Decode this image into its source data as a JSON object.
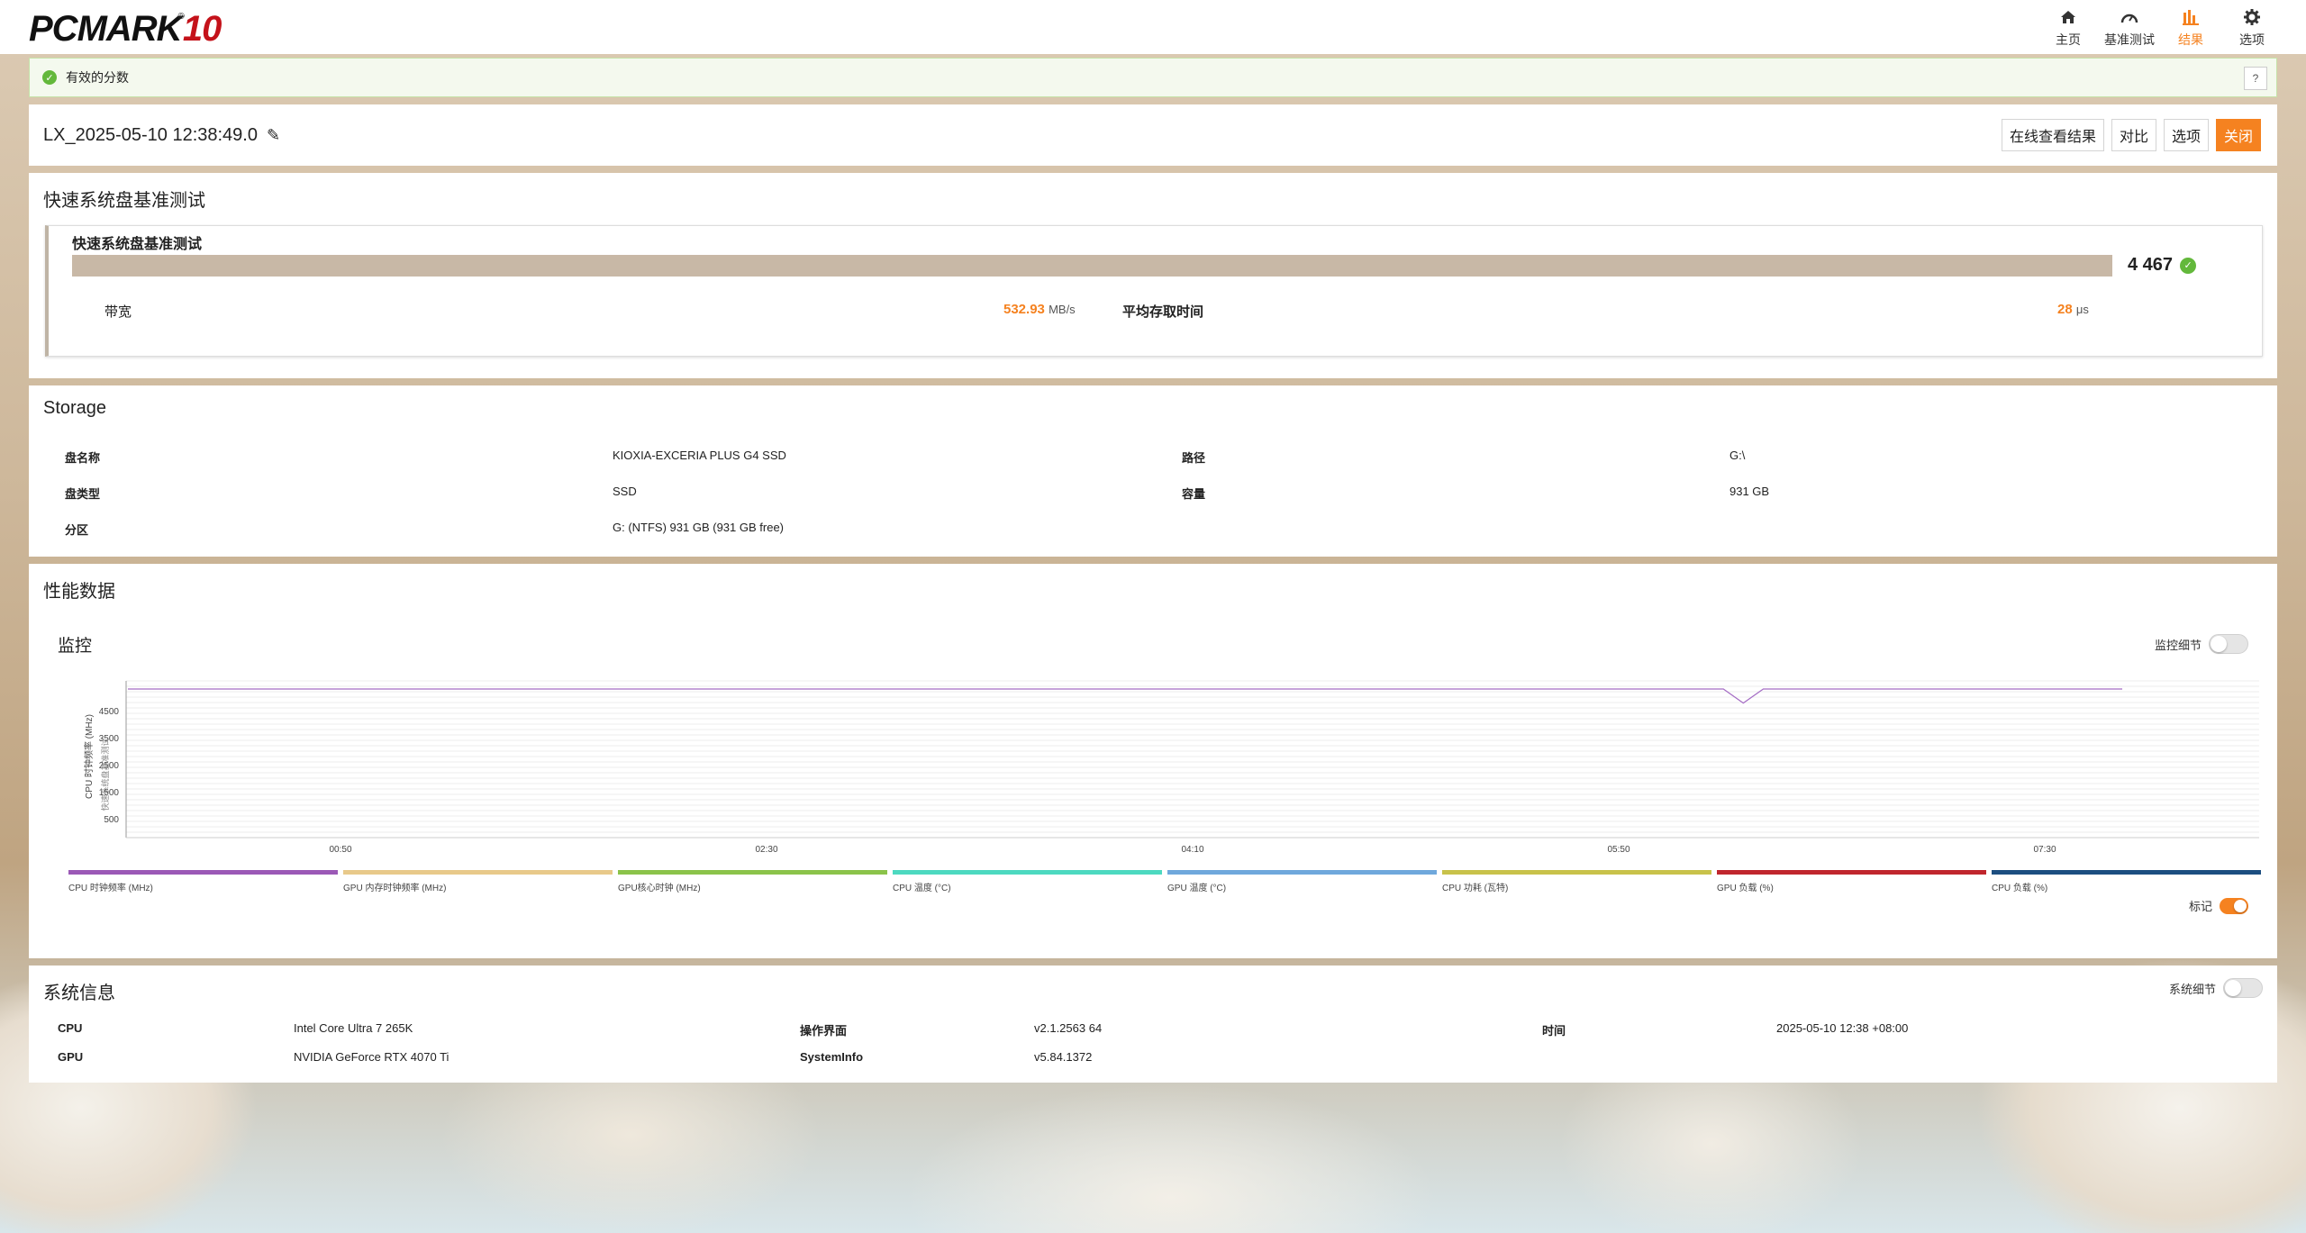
{
  "app": {
    "logo_text": "PCMARK",
    "logo_number": "10",
    "logo_reg": "®"
  },
  "nav": [
    {
      "label": "主页",
      "icon": "home-icon"
    },
    {
      "label": "基准测试",
      "icon": "gauge-icon"
    },
    {
      "label": "结果",
      "icon": "bar-chart-icon",
      "active": true
    },
    {
      "label": "选项",
      "icon": "gear-icon"
    }
  ],
  "status": {
    "text": "有效的分数",
    "help": "?"
  },
  "result": {
    "title": "LX_2025-05-10 12:38:49.0",
    "buttons": {
      "online": "在线查看结果",
      "compare": "对比",
      "options": "选项",
      "close": "关闭"
    }
  },
  "benchmark": {
    "section": "快速系统盘基准测试",
    "sub": "快速系统盘基准测试",
    "score": "4 467",
    "bandwidth_label": "带宽",
    "bandwidth_value": "532.93",
    "bandwidth_unit": "MB/s",
    "latency_label": "平均存取时间",
    "latency_value": "28",
    "latency_unit": "μs"
  },
  "storage": {
    "section": "Storage",
    "rows": [
      {
        "k1": "盘名称",
        "v1": "KIOXIA-EXCERIA PLUS G4 SSD",
        "k2": "路径",
        "v2": "G:\\"
      },
      {
        "k1": "盘类型",
        "v1": "SSD",
        "k2": "容量",
        "v2": "931 GB"
      },
      {
        "k1": "分区",
        "v1": "G: (NTFS) 931 GB (931 GB free)",
        "k2": "",
        "v2": ""
      }
    ]
  },
  "perf": {
    "section": "性能数据",
    "monitor": "监控",
    "monitor_toggle_label": "监控细节",
    "markers_label": "标记",
    "legend": [
      {
        "name": "CPU 时钟频率 (MHz)",
        "color": "#9b59b6"
      },
      {
        "name": "GPU 内存时钟频率 (MHz)",
        "color": "#e8c98a"
      },
      {
        "name": "GPU核心时钟 (MHz)",
        "color": "#8bc34a"
      },
      {
        "name": "CPU 温度 (°C)",
        "color": "#4dd9c0"
      },
      {
        "name": "GPU 温度 (°C)",
        "color": "#6fa8dc"
      },
      {
        "name": "CPU 功耗 (瓦特)",
        "color": "#c8c24a"
      },
      {
        "name": "GPU 负载 (%)",
        "color": "#c0262d"
      },
      {
        "name": "CPU 负载 (%)",
        "color": "#1c4e80"
      }
    ]
  },
  "chart_data": {
    "type": "line",
    "ylabel": "CPU 时钟频率 (MHz)",
    "ylabel2": "快速系统盘基准测试",
    "yticks": [
      500,
      1500,
      2500,
      3500,
      4500
    ],
    "ylim": [
      0,
      5600
    ],
    "xticks": [
      "00:50",
      "02:30",
      "04:10",
      "05:50",
      "07:30"
    ],
    "series": [
      {
        "name": "CPU 时钟频率 (MHz)",
        "values": [
          5300,
          5300,
          5300,
          5300,
          5300,
          5300,
          5300,
          5300,
          5300,
          5300,
          5300,
          5300,
          5300,
          5300,
          5300,
          5300,
          5300,
          5300,
          5300,
          5300,
          5300,
          5300,
          5300,
          5300,
          5300,
          5300,
          5300,
          5300,
          5300,
          5300,
          5300,
          5300,
          5300,
          5300,
          5300,
          5300,
          5300,
          5300,
          5300,
          5300,
          5300,
          5300,
          5300,
          5300,
          5300,
          5300,
          5300,
          5300,
          5300,
          5300,
          5300,
          5300,
          5300,
          5300,
          5300,
          5300,
          5300,
          5300,
          5300,
          5300,
          5300,
          5300,
          5300,
          5300,
          5300,
          5300,
          5300,
          5300,
          5300,
          5300,
          5300,
          5300,
          5300,
          5300,
          5300,
          5300,
          5300,
          5300,
          5300,
          5300,
          5300,
          4780,
          5300,
          5300,
          5300,
          5300,
          5300,
          5300,
          5300,
          5300,
          5300,
          5300,
          5300,
          5300,
          5300,
          5300,
          5300,
          5300,
          5300,
          5300,
          5300
        ]
      }
    ]
  },
  "sysinfo": {
    "section": "系统信息",
    "toggle_label": "系统细节",
    "cpu_k": "CPU",
    "cpu_v": "Intel Core Ultra 7 265K",
    "gpu_k": "GPU",
    "gpu_v": "NVIDIA GeForce RTX 4070 Ti",
    "os_k": "操作界面",
    "os_v": "v2.1.2563 64",
    "si_k": "SystemInfo",
    "si_v": "v5.84.1372",
    "time_k": "时间",
    "time_v": "2025-05-10 12:38 +08:00"
  }
}
